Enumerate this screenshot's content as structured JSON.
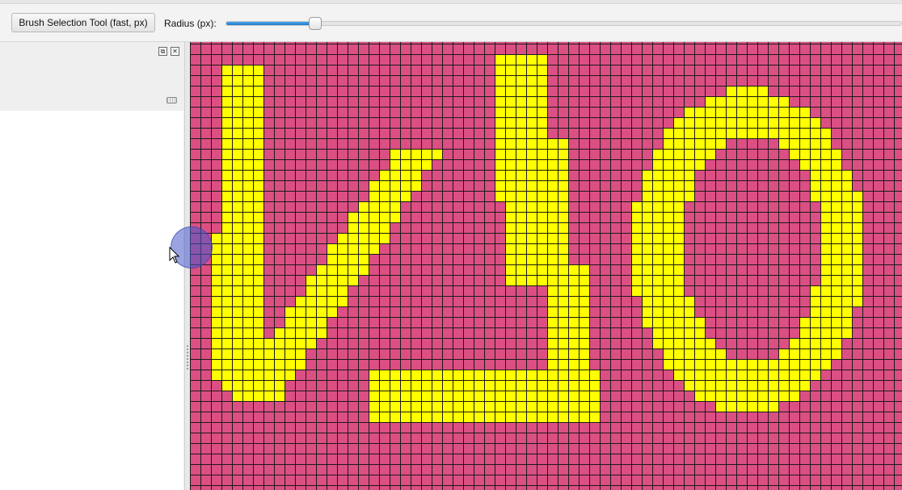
{
  "toolbar": {
    "brush_button_label": "Brush Selection Tool (fast, px)",
    "radius_label": "Radius (px):",
    "radius_slider_fraction": 0.135
  },
  "dock": {
    "float_icon": "float-icon",
    "close_icon": "close-icon"
  },
  "canvas": {
    "background_color": "#db4f83",
    "selection_color": "#ffff00",
    "grid_line_color": "#1a1a1a",
    "grid_columns": 68,
    "grid_rows": 43
  },
  "icons": {
    "cursor": "mouse-pointer-icon",
    "brush": "brush-cursor"
  }
}
